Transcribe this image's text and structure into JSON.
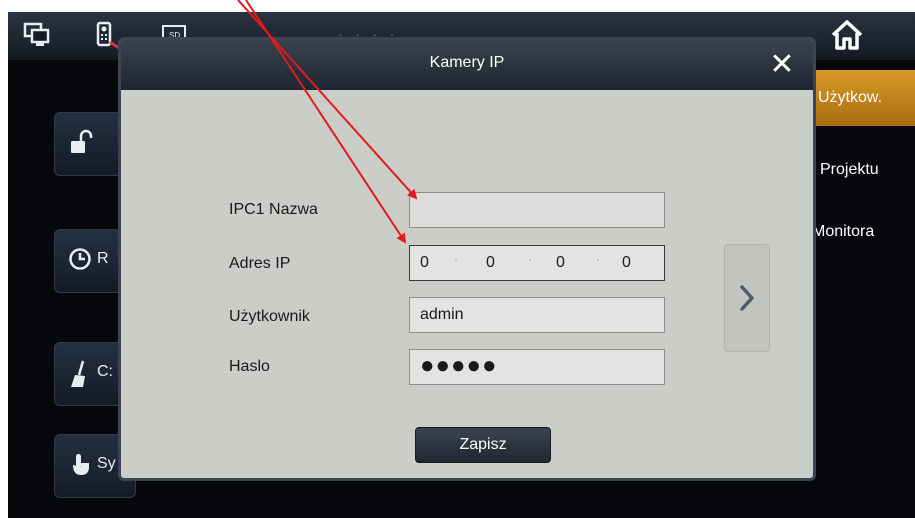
{
  "dialog": {
    "title": "Kamery IP",
    "fields": {
      "name_label": "IPC1 Nazwa",
      "name_value": "",
      "ip_label": "Adres IP",
      "ip_octets": [
        "0",
        "0",
        "0",
        "0"
      ],
      "user_label": "Użytkownik",
      "user_value": "admin",
      "password_label": "Haslo",
      "password_value": "●●●●●"
    },
    "save_label": "Zapisz"
  },
  "right_tabs": [
    "Użytkow.",
    "Projektu",
    "Monitora"
  ],
  "left_buttons": [
    "R",
    "C:",
    "Sy"
  ],
  "colors": {
    "active_tab": "#d99a28",
    "dialog_bg": "#cbcdc9",
    "annotation_arrow": "#e21b1b"
  },
  "icons": {
    "top": [
      "monitor-icon",
      "intercom-icon",
      "sd-card-icon"
    ],
    "home": "home-icon",
    "close": "close-icon",
    "next": "chevron-right-icon"
  }
}
